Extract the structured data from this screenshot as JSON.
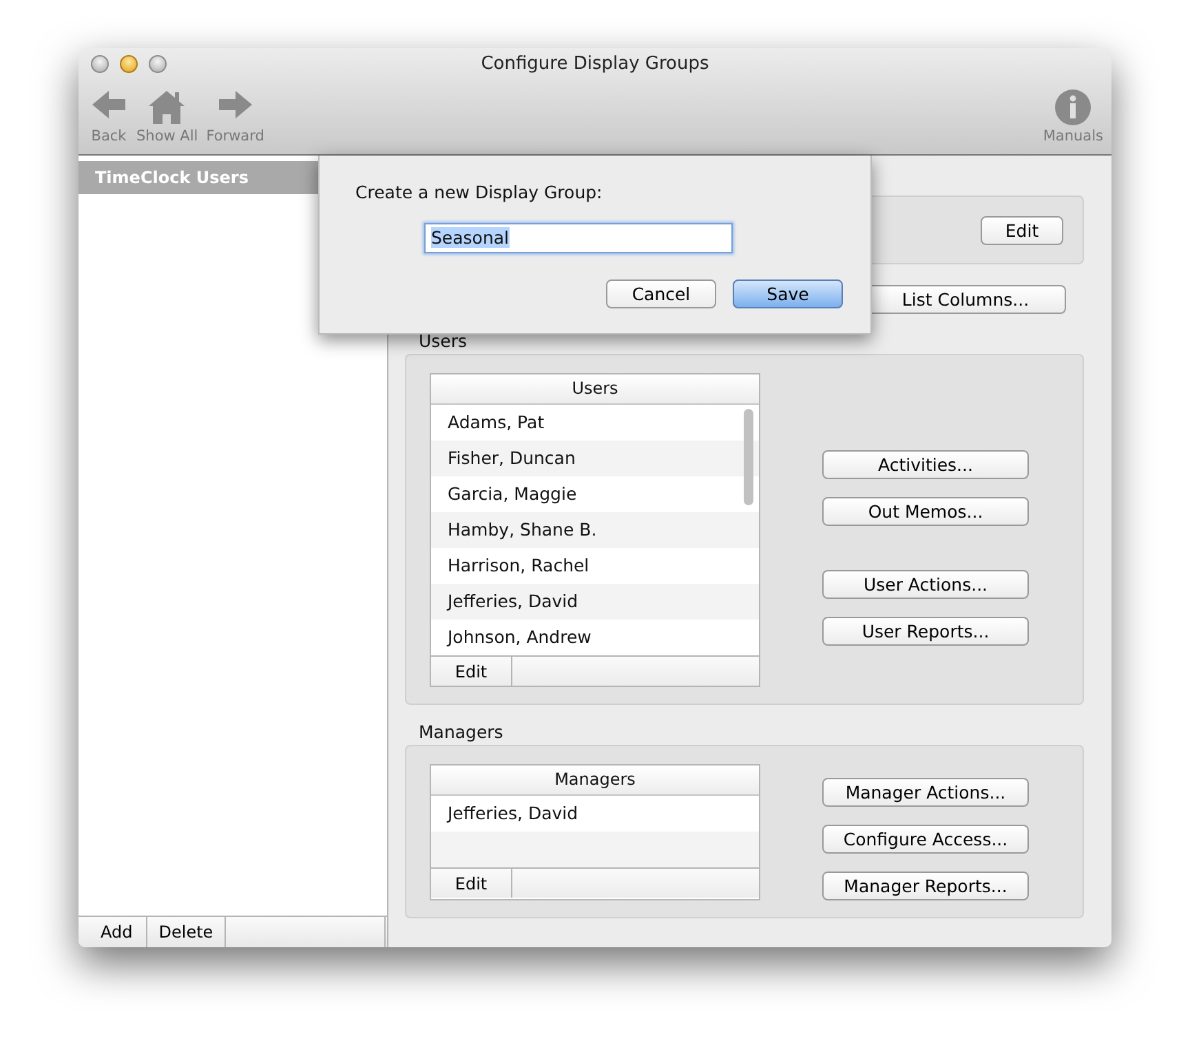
{
  "window": {
    "title": "Configure Display Groups"
  },
  "toolbar": {
    "left": [
      {
        "kind": "back",
        "label": "Back"
      },
      {
        "kind": "home",
        "label": "Show All"
      },
      {
        "kind": "forward",
        "label": "Forward"
      }
    ],
    "right": [
      {
        "kind": "info",
        "label": "Manuals"
      }
    ]
  },
  "sidebar": {
    "items": [
      {
        "label": "TimeClock Users",
        "selected": true
      }
    ],
    "buttons": [
      "Add",
      "Delete"
    ]
  },
  "group": {
    "edit_button": "Edit",
    "list_columns_button": "List Columns..."
  },
  "users": {
    "section_label": "Users",
    "column": "Users",
    "rows": [
      "Adams, Pat",
      "Fisher, Duncan",
      "Garcia, Maggie",
      "Hamby, Shane B.",
      "Harrison, Rachel",
      "Jefferies, David",
      "Johnson, Andrew"
    ],
    "edit_button": "Edit",
    "buttons": [
      "Activities...",
      "Out Memos...",
      "User Actions...",
      "User Reports..."
    ]
  },
  "managers": {
    "section_label": "Managers",
    "column": "Managers",
    "rows": [
      "Jefferies, David"
    ],
    "edit_button": "Edit",
    "buttons": [
      "Manager Actions...",
      "Configure Access...",
      "Manager Reports..."
    ]
  },
  "sheet": {
    "prompt": "Create a new Display Group:",
    "value": "Seasonal",
    "buttons": [
      {
        "label": "Cancel",
        "default": false
      },
      {
        "label": "Save",
        "default": true
      }
    ]
  }
}
